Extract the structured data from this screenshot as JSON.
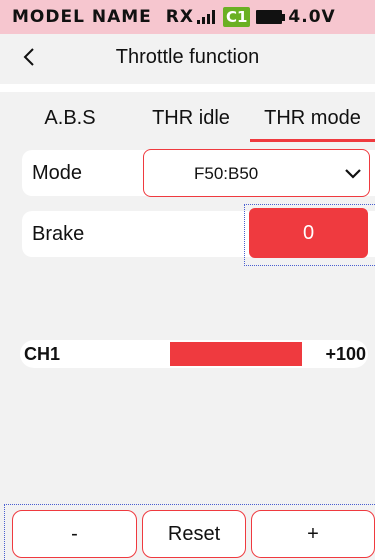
{
  "status_bar": {
    "model_name": "MODEL NAME",
    "receiver_label": "RX",
    "channel_badge": "C1",
    "battery_voltage": "4.0V",
    "signal_icon": "signal-bars-icon",
    "battery_icon": "battery-icon",
    "background_color": "#f6c6cf",
    "badge_color": "#6ab023"
  },
  "header": {
    "title": "Throttle function",
    "back_icon": "back-chevron-icon"
  },
  "tabs": [
    {
      "label": "A.B.S",
      "active": false
    },
    {
      "label": "THR idle",
      "active": false
    },
    {
      "label": "THR mode",
      "active": true
    }
  ],
  "settings": {
    "mode": {
      "label": "Mode",
      "value": "F50:B50",
      "dropdown_icon": "chevron-down-icon"
    },
    "brake": {
      "label": "Brake",
      "value": "0"
    }
  },
  "channel_monitor": {
    "label": "CH1",
    "value": "+100",
    "level": 1.0
  },
  "bottom_buttons": {
    "minus": "-",
    "reset": "Reset",
    "plus": "+"
  },
  "accent_color": "#ef3a3f",
  "focus_color": "#4a5fd0"
}
